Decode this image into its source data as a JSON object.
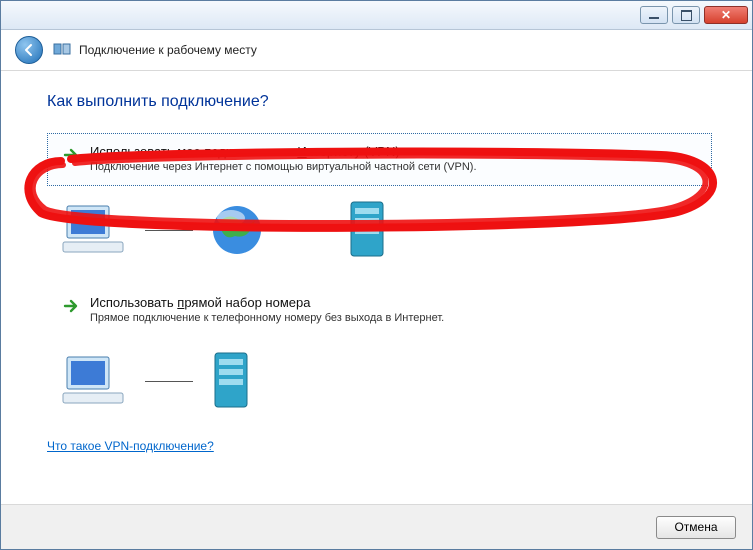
{
  "window": {
    "title": "Подключение к рабочему месту"
  },
  "question": "Как выполнить подключение?",
  "options": {
    "vpn": {
      "title_before": "Использовать мое подключение к ",
      "title_ul": "И",
      "title_after": "нтернету (VPN)",
      "desc": "Подключение через Интернет с помощью виртуальной частной сети (VPN)."
    },
    "dialup": {
      "title_before": "Использовать ",
      "title_ul": "п",
      "title_after": "рямой набор номера",
      "desc": "Прямое подключение к телефонному номеру без выхода в Интернет."
    }
  },
  "help_link": "Что такое VPN-подключение?",
  "footer": {
    "cancel": "Отмена"
  }
}
